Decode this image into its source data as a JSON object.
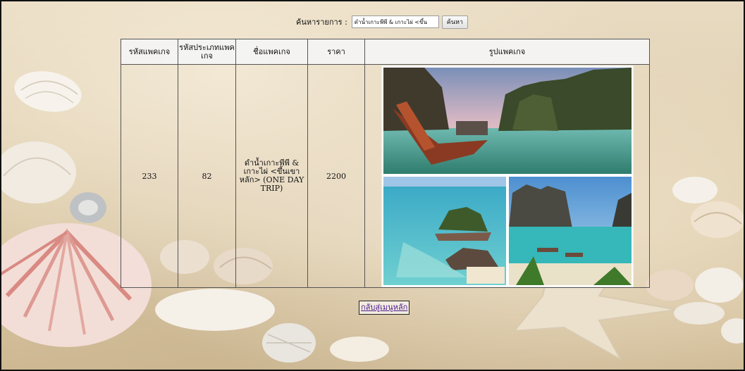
{
  "search": {
    "label": "ค้นหารายการ :",
    "value": "ดำน้ำเกาะพีพี & เกาะไผ่ <ขึ้น",
    "button": "ค้นหา"
  },
  "table": {
    "headers": [
      "รหัสแพคเกจ",
      "รหัสประเภทแพคเกจ",
      "ชื่อแพคเกจ",
      "ราคา",
      "รูปแพคเกจ"
    ],
    "rows": [
      {
        "package_id": "233",
        "type_id": "82",
        "name": "ดำน้ำเกาะพีพี & เกาะไผ่ <ขึ้นเขาหลัก> (ONE DAY TRIP)",
        "price": "2200",
        "image": "phi-phi-island-collage"
      }
    ]
  },
  "back_link": "กลับสู่เมนูหลัก",
  "icons": [
    "seashell-icon",
    "starfish-icon"
  ],
  "colors": {
    "sand": "#dccaa8",
    "header_bg": "#f4f4f4",
    "link": "#4a1a8a",
    "sea": "#3fb9c0"
  }
}
